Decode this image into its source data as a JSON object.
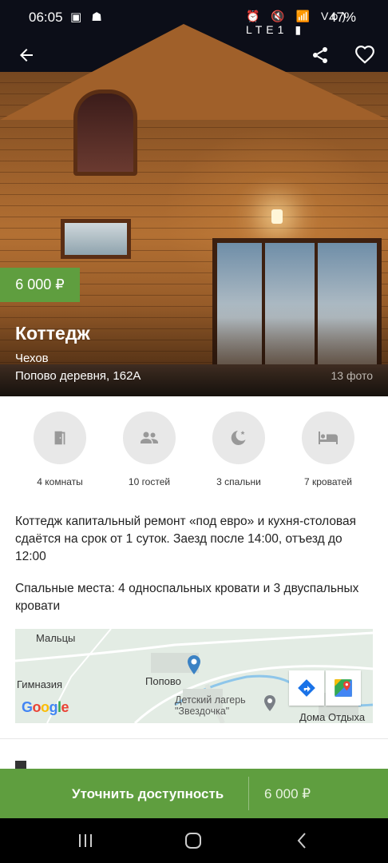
{
  "status_bar": {
    "time": "06:05",
    "left_icons": "▣ ☗",
    "right_icons": "⏰ 🔇 📶 Vo) LTE1 ▮",
    "battery": "47%"
  },
  "header": {
    "back_icon": "arrow-left-icon",
    "share_icon": "share-icon",
    "favorite_icon": "heart-outline-icon"
  },
  "listing": {
    "price_badge": "6 000 ₽",
    "title": "Коттедж",
    "city": "Чехов",
    "address": "Попово деревня, 162А",
    "photo_count": "13 фото"
  },
  "features": [
    {
      "icon": "door-icon",
      "label": "4 комнаты"
    },
    {
      "icon": "guests-icon",
      "label": "10 гостей"
    },
    {
      "icon": "moon-icon",
      "label": "3 спальни"
    },
    {
      "icon": "bed-icon",
      "label": "7 кроватей"
    }
  ],
  "description": {
    "paragraph1": "Коттедж капитальный ремонт «под евро» и кухня-столовая сдаётся на срок от 1 суток. Заезд после 14:00, отъезд до 12:00",
    "paragraph2": "Спальные места: 4 односпальных кровати и 3 двуспальных кровати"
  },
  "map": {
    "labels": {
      "maltsy": "Мальцы",
      "gymnasium": "Гимназия",
      "popovo": "Попово",
      "camp": "Детский лагерь \"Звездочка\"",
      "houses": "Дома Отдыха"
    },
    "logo": "Google",
    "directions_icon": "directions-icon",
    "maps_icon": "google-maps-icon"
  },
  "cta": {
    "label": "Уточнить доступность",
    "price": "6 000 ₽",
    "color": "#5f9e3f"
  },
  "nav_bar": {
    "recents_icon": "recents-icon",
    "home_icon": "home-icon",
    "back_icon": "back-chevron-icon"
  }
}
